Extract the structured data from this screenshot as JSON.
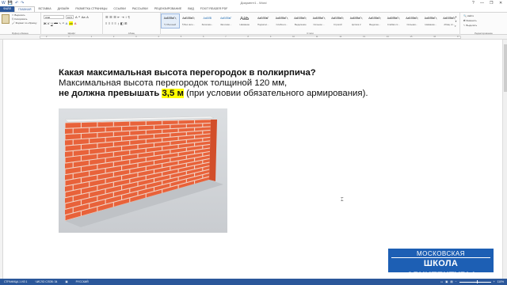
{
  "window": {
    "title": "Документ1 - Word",
    "controls": [
      "?",
      "—",
      "❐",
      "✕"
    ]
  },
  "qat": [
    "W",
    "💾",
    "↶",
    "↷"
  ],
  "tabs": [
    "ФАЙЛ",
    "ГЛАВНАЯ",
    "ВСТАВКА",
    "ДИЗАЙН",
    "РАЗМЕТКА СТРАНИЦЫ",
    "ССЫЛКИ",
    "РАССЫЛКИ",
    "РЕЦЕНЗИРОВАНИЕ",
    "ВИД",
    "FOXIT READER PDF"
  ],
  "ribbon": {
    "clipboard": {
      "label": "Буфер обмена",
      "paste": "Вставить",
      "cut": "Вырезать",
      "copy": "Копировать",
      "format_painter": "Формат по образцу"
    },
    "font": {
      "label": "Шрифт",
      "font_name": "Arial",
      "font_size": "10,5",
      "grow": "A",
      "shrink": "A",
      "case": "Aa",
      "clear": "A",
      "bold": "Ж",
      "italic": "К",
      "underline": "Ч",
      "strike": "abc",
      "sub": "x₂",
      "sup": "x²"
    },
    "paragraph": {
      "label": "Абзац"
    },
    "styles": {
      "label": "Стили",
      "items": [
        {
          "preview": "АаБбВвГг,",
          "name": "¶ Обычный"
        },
        {
          "preview": "АаБбВвГг,",
          "name": "¶ Без инте..."
        },
        {
          "preview": "АаБбВ",
          "name": "Заголово..."
        },
        {
          "preview": "АаБбВвГ",
          "name": "Заголово..."
        },
        {
          "preview": "АаБ",
          "name": "Название"
        },
        {
          "preview": "АаБбВвГ",
          "name": "Подзагол..."
        },
        {
          "preview": "АаБбВвГг,",
          "name": "Слабое в..."
        },
        {
          "preview": "АаБбВвГг,",
          "name": "Выделение"
        },
        {
          "preview": "АаБбВвГг,",
          "name": "Сильное ..."
        },
        {
          "preview": "АаБбВвГг,",
          "name": "Строгий"
        },
        {
          "preview": "АаБбВвГг,",
          "name": "Цитата 2"
        },
        {
          "preview": "АаБбВвГг,",
          "name": "Выделен..."
        },
        {
          "preview": "АаБбВвГг,",
          "name": "Слабая сс..."
        },
        {
          "preview": "АаБбВвГг,",
          "name": "Сильная..."
        },
        {
          "preview": "АаБбВвГг,",
          "name": "Название..."
        },
        {
          "preview": "АаБбВвГг,",
          "name": "Абзац сп..."
        }
      ]
    },
    "editing": {
      "label": "Редактирование",
      "find": "Найти",
      "replace": "Заменить",
      "select": "Выделить"
    }
  },
  "ruler": {
    "numbers": [
      "2",
      "1",
      "1",
      "2",
      "3",
      "4",
      "5",
      "6",
      "7",
      "8",
      "9",
      "10",
      "11",
      "12",
      "13",
      "14",
      "15",
      "16",
      "17"
    ]
  },
  "document": {
    "question": "Какая максимальная высота перегородок в полкирпича?",
    "line2": "Максимальная высота перегородок толщиной 120 мм,",
    "line3_bold": "не должна превышать",
    "line3_highlight": "3,5 м",
    "line3_rest": "(при условии обязательного армирования)."
  },
  "statusbar": {
    "page": "СТРАНИЦА 1 ИЗ 1",
    "words": "ЧИСЛО СЛОВ: 34",
    "language": "РУССКИЙ",
    "zoom": "110%"
  },
  "logo": {
    "line1": "МОСКОВСКАЯ",
    "line2": "ШКОЛА АРХИТЕКТУРЫ"
  },
  "colors": {
    "accent": "#2b579a",
    "brick": "#e8623a",
    "highlight": "#ffff00",
    "logo_bg": "#1d5fb4"
  }
}
